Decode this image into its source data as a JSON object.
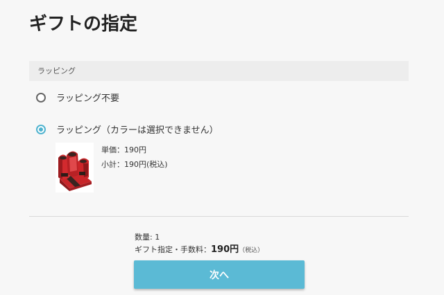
{
  "page": {
    "title": "ギフトの指定"
  },
  "wrapping_section": {
    "header": "ラッピング",
    "options": [
      {
        "label": "ラッピング不要",
        "selected": false
      },
      {
        "label": "ラッピング（カラーは選択できません）",
        "selected": true
      }
    ],
    "product": {
      "image_icon": "gift-bag-image",
      "unit_price": "単価：190円",
      "subtotal": "小計：190円(税込)"
    }
  },
  "summary": {
    "quantity": "数量: 1",
    "fee_label": "ギフト指定・手数料：",
    "fee_amount": "190円",
    "fee_tax": "（税込）"
  },
  "actions": {
    "next_label": "次へ"
  },
  "colors": {
    "accent": "#5bbad5",
    "radio_selected": "#4fb3cf"
  }
}
